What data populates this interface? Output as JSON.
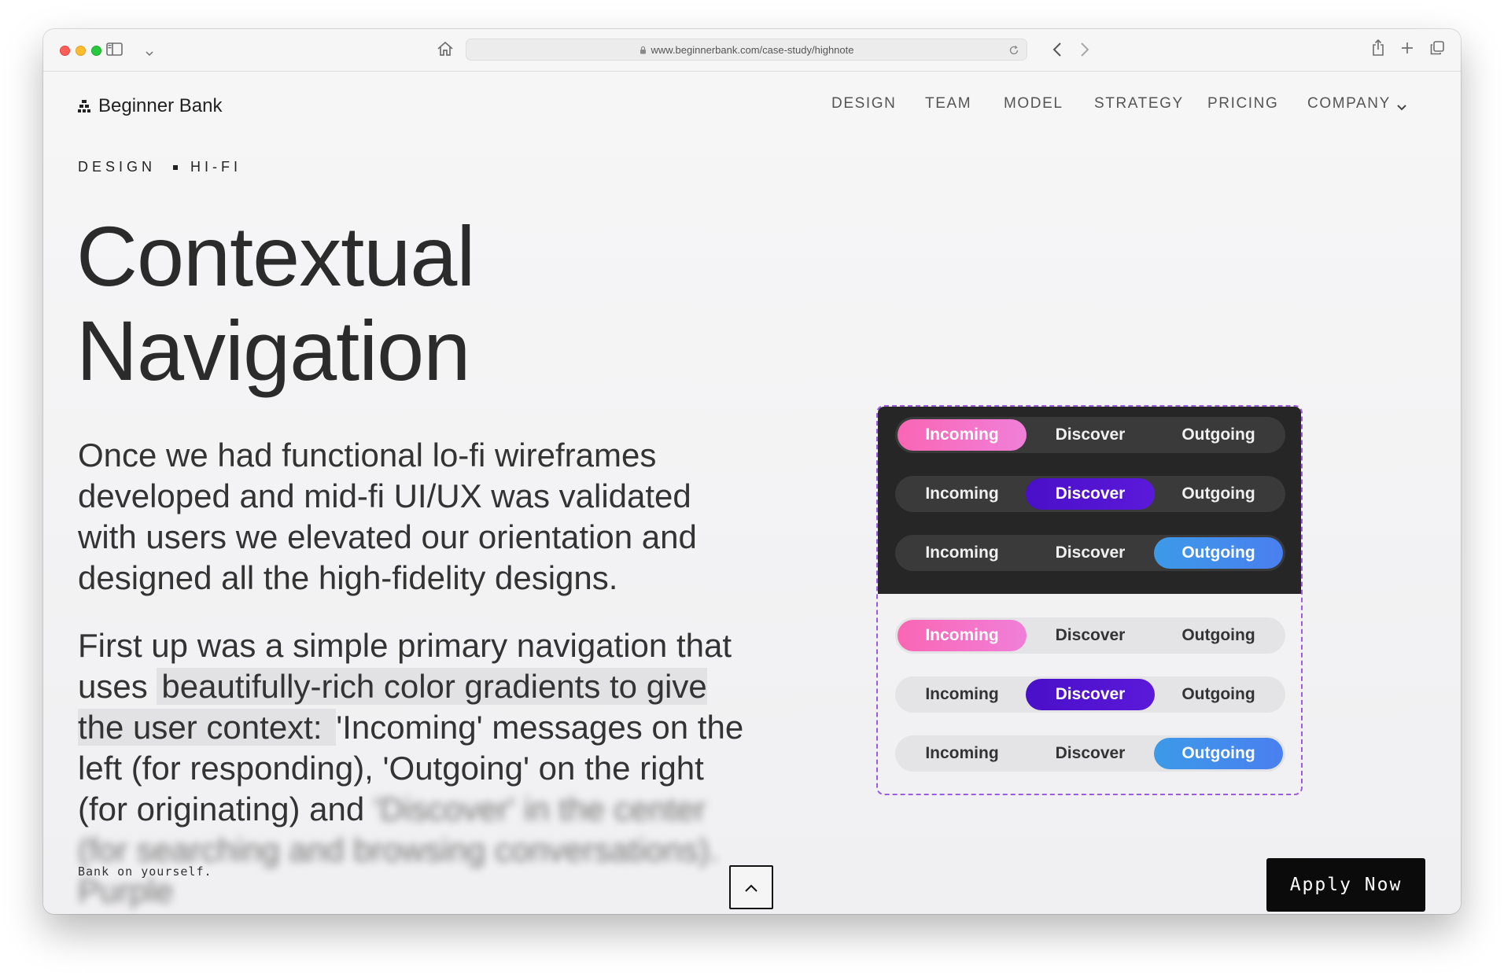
{
  "browser": {
    "url": "www.beginnerbank.com/case-study/highnote"
  },
  "site": {
    "logo_text": "Beginner Bank",
    "nav": [
      "DESIGN",
      "TEAM",
      "MODEL",
      "STRATEGY",
      "PRICING",
      "COMPANY"
    ]
  },
  "breadcrumb": {
    "section": "DESIGN",
    "sub": "HI-FI"
  },
  "article": {
    "title_line1": "Contextual",
    "title_line2": "Navigation",
    "p1": "Once we had functional lo-fi wireframes developed and mid-fi UI/UX was validated with users we elevated our orientation and designed all the high-fidelity designs.",
    "p2_a": "First up was a simple primary navigation that uses ",
    "p2_highlight": "beautifully-rich color gradients to give the user context: ",
    "p2_b": " 'Incoming' messages on the left (for responding), 'Outgoing' on the right (for originating) and ",
    "p2_faded": "'Discover' in the center (for searching and browsing conversations). Purple"
  },
  "showcase": {
    "segments": [
      "Incoming",
      "Discover",
      "Outgoing"
    ],
    "accent_colors": {
      "incoming": "#fa66b4",
      "discover": "#4a0fc9",
      "outgoing": "#3c9ae8"
    }
  },
  "footer": {
    "tagline": "Bank on yourself.",
    "apply_label": "Apply Now",
    "back_to_top_icon": "chevron-up-icon"
  }
}
